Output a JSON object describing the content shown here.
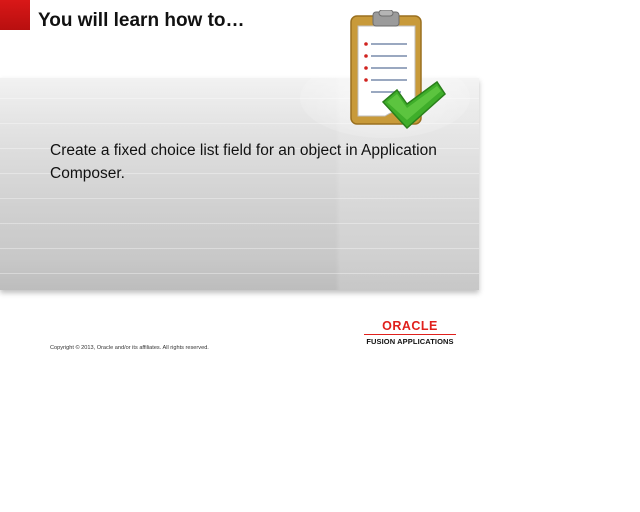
{
  "header": {
    "title": "You will learn how to…"
  },
  "main": {
    "objective_text": "Create a fixed choice list field for an object in Application Composer."
  },
  "footer": {
    "copyright": "Copyright © 2013, Oracle and/or its affiliates. All rights reserved.",
    "logo_word": "ORACLE",
    "logo_subtitle": "FUSION APPLICATIONS"
  },
  "icons": {
    "illustration": "clipboard-checkmark-icon"
  },
  "colors": {
    "accent_red": "#d91818",
    "oracle_red": "#e0201c",
    "check_green": "#3fae2a"
  }
}
